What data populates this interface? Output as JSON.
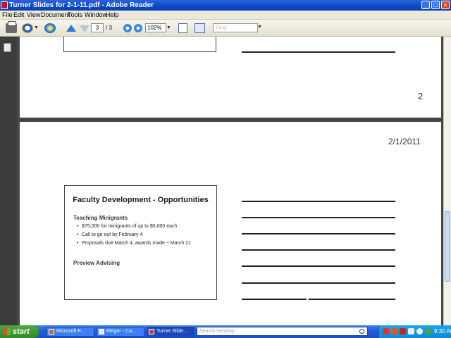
{
  "window": {
    "title": "Turner Slides for 2-1-11.pdf - Adobe Reader",
    "controls": [
      "_",
      "□",
      "×"
    ]
  },
  "menubar": {
    "items": [
      "File",
      "Edit",
      "View",
      "Document",
      "Tools",
      "Window",
      "Help"
    ]
  },
  "toolbar": {
    "current_page": "3",
    "page_total": "/  3",
    "zoom": "102%",
    "find_placeholder": "Find"
  },
  "document": {
    "page_number": "2",
    "date": "2/1/2011",
    "slide": {
      "title": "Faculty Development - Opportunities",
      "heading1": "Teaching Minigrants",
      "bullets": [
        "$75,000 for minigrants of up to $5,000 each",
        "Call to go out by February 4",
        "Proposals due March 4, awards made ~ March 21"
      ],
      "heading2": "Preview Advising"
    }
  },
  "taskbar": {
    "start_label": "start",
    "tasks": [
      "Microsoft P...",
      "Rieger - CA...",
      "Turner Slide..."
    ],
    "search_placeholder": "Search Desktop",
    "clock": "9:30 AM"
  },
  "colors": {
    "titlebar": "#0a48c8",
    "taskbar": "#245edb",
    "start": "#2f8a2a",
    "doc_background": "#464646"
  }
}
